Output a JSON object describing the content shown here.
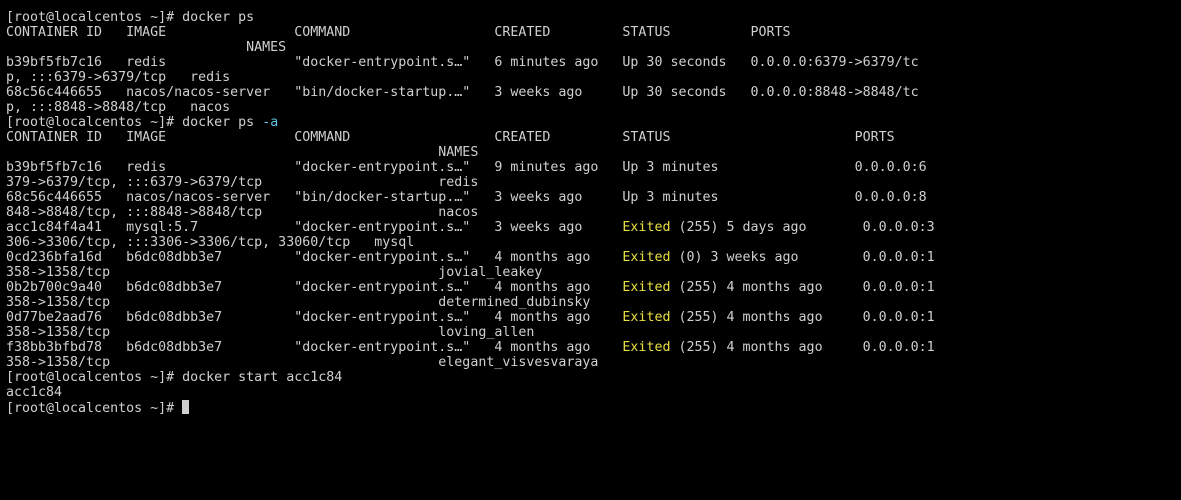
{
  "terminal": {
    "colors": {
      "background": "#000000",
      "foreground": "#d0d0d0",
      "exited": "#e8e040",
      "flag": "#5fc4e8",
      "cursor": "#d0d0d0"
    },
    "lines": [
      [
        {
          "t": "[root@localcentos ~]# docker ps"
        }
      ],
      [
        {
          "t": "CONTAINER ID   IMAGE                COMMAND                  CREATED         STATUS          PORTS"
        }
      ],
      [
        {
          "t": "                              NAMES"
        }
      ],
      [
        {
          "t": "b39bf5fb7c16   redis                \"docker-entrypoint.s…\"   6 minutes ago   Up 30 seconds   0.0.0.0:6379->6379/tc"
        }
      ],
      [
        {
          "t": "p, :::6379->6379/tcp   redis"
        }
      ],
      [
        {
          "t": "68c56c446655   nacos/nacos-server   \"bin/docker-startup.…\"   3 weeks ago     Up 30 seconds   0.0.0.0:8848->8848/tc"
        }
      ],
      [
        {
          "t": "p, :::8848->8848/tcp   nacos"
        }
      ],
      [
        {
          "t": "[root@localcentos ~]# docker ps "
        },
        {
          "t": "-a",
          "c": "cyan"
        }
      ],
      [
        {
          "t": "CONTAINER ID   IMAGE                COMMAND                  CREATED         STATUS                       PORTS"
        }
      ],
      [
        {
          "t": "                                                      NAMES"
        }
      ],
      [
        {
          "t": "b39bf5fb7c16   redis                \"docker-entrypoint.s…\"   9 minutes ago   Up 3 minutes                 0.0.0.0:6"
        }
      ],
      [
        {
          "t": "379->6379/tcp, :::6379->6379/tcp                      redis"
        }
      ],
      [
        {
          "t": "68c56c446655   nacos/nacos-server   \"bin/docker-startup.…\"   3 weeks ago     Up 3 minutes                 0.0.0.0:8"
        }
      ],
      [
        {
          "t": "848->8848/tcp, :::8848->8848/tcp                      nacos"
        }
      ],
      [
        {
          "t": "acc1c84f4a41   mysql:5.7            \"docker-entrypoint.s…\"   3 weeks ago     "
        },
        {
          "t": "Exited",
          "c": "yellow"
        },
        {
          "t": " (255) 5 days ago       0.0.0.0:3"
        }
      ],
      [
        {
          "t": "306->3306/tcp, :::3306->3306/tcp, 33060/tcp   mysql"
        }
      ],
      [
        {
          "t": "0cd236bfa16d   b6dc08dbb3e7         \"docker-entrypoint.s…\"   4 months ago    "
        },
        {
          "t": "Exited",
          "c": "yellow"
        },
        {
          "t": " (0) 3 weeks ago        0.0.0.0:1"
        }
      ],
      [
        {
          "t": "358->1358/tcp                                         jovial_leakey"
        }
      ],
      [
        {
          "t": "0b2b700c9a40   b6dc08dbb3e7         \"docker-entrypoint.s…\"   4 months ago    "
        },
        {
          "t": "Exited",
          "c": "yellow"
        },
        {
          "t": " (255) 4 months ago     0.0.0.0:1"
        }
      ],
      [
        {
          "t": "358->1358/tcp                                         determined_dubinsky"
        }
      ],
      [
        {
          "t": "0d77be2aad76   b6dc08dbb3e7         \"docker-entrypoint.s…\"   4 months ago    "
        },
        {
          "t": "Exited",
          "c": "yellow"
        },
        {
          "t": " (255) 4 months ago     0.0.0.0:1"
        }
      ],
      [
        {
          "t": "358->1358/tcp                                         loving_allen"
        }
      ],
      [
        {
          "t": "f38bb3bfbd78   b6dc08dbb3e7         \"docker-entrypoint.s…\"   4 months ago    "
        },
        {
          "t": "Exited",
          "c": "yellow"
        },
        {
          "t": " (255) 4 months ago     0.0.0.0:1"
        }
      ],
      [
        {
          "t": "358->1358/tcp                                         elegant_visvesvaraya"
        }
      ],
      [
        {
          "t": "[root@localcentos ~]# docker start acc1c84"
        }
      ],
      [
        {
          "t": "acc1c84"
        }
      ],
      [
        {
          "t": "[root@localcentos ~]# "
        }
      ]
    ]
  }
}
